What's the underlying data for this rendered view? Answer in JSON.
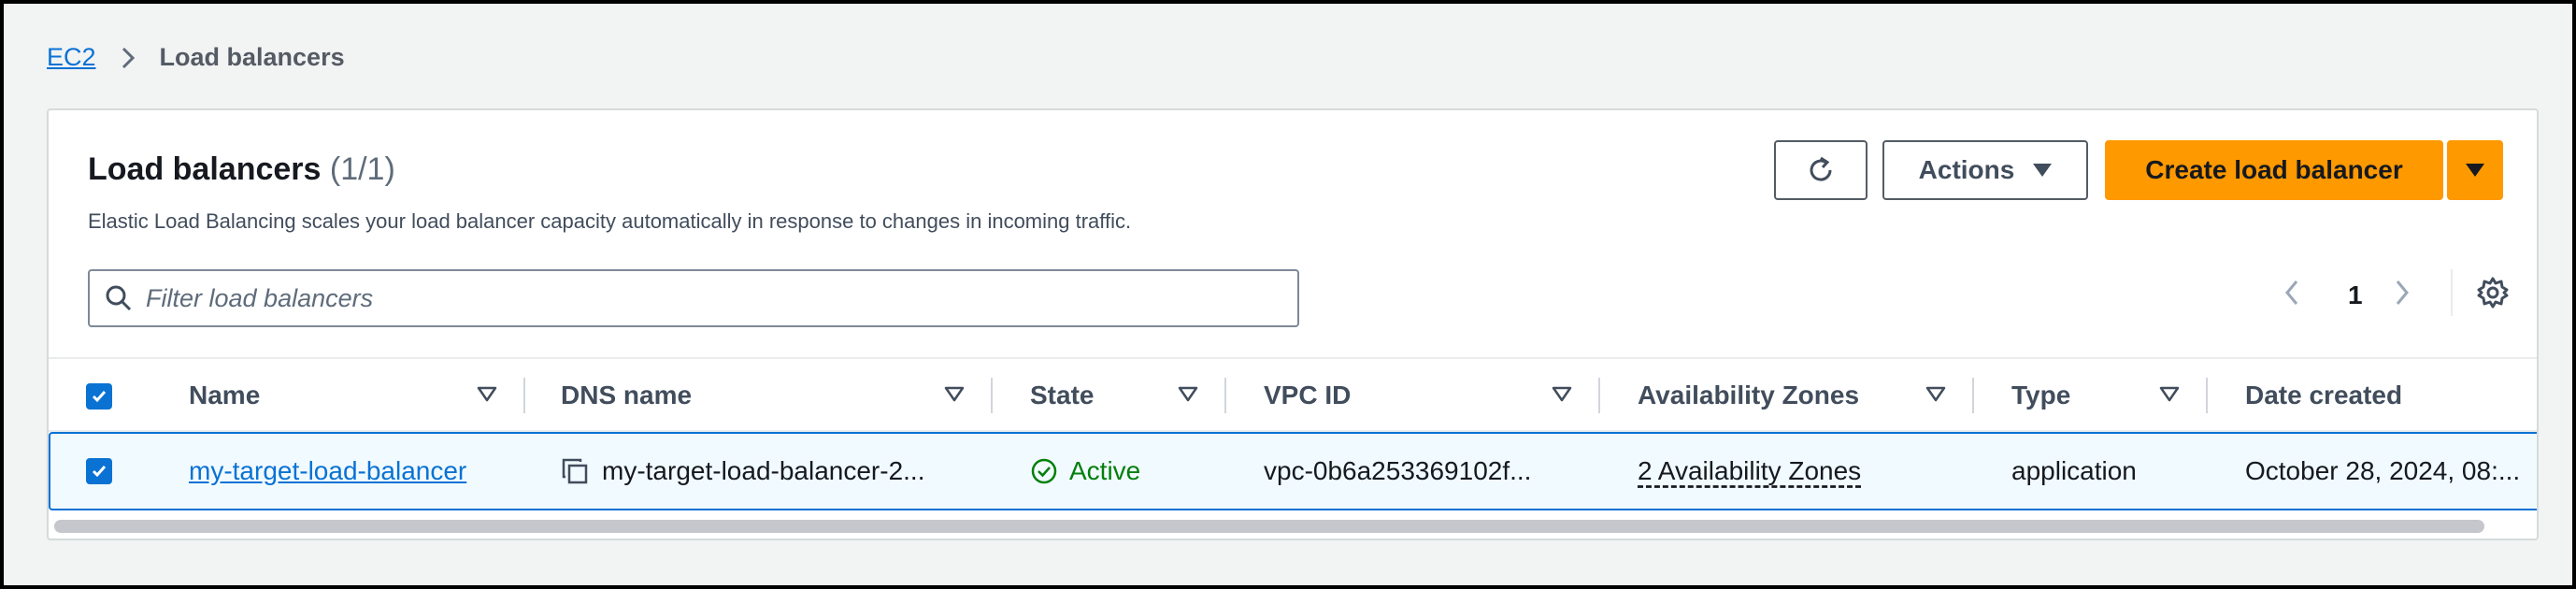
{
  "breadcrumb": {
    "root": "EC2",
    "current": "Load balancers"
  },
  "header": {
    "title": "Load balancers",
    "count": "(1/1)",
    "description": "Elastic Load Balancing scales your load balancer capacity automatically in response to changes in incoming traffic."
  },
  "toolbar": {
    "actions_label": "Actions",
    "create_label": "Create load balancer"
  },
  "filter": {
    "placeholder": "Filter load balancers"
  },
  "pagination": {
    "current_page": "1"
  },
  "table": {
    "columns": [
      "Name",
      "DNS name",
      "State",
      "VPC ID",
      "Availability Zones",
      "Type",
      "Date created"
    ],
    "rows": [
      {
        "name": "my-target-load-balancer",
        "dns_name": "my-target-load-balancer-2...",
        "state": "Active",
        "vpc_id": "vpc-0b6a253369102f...",
        "availability_zones": "2 Availability Zones",
        "type": "application",
        "date_created": "October 28, 2024, 08:..."
      }
    ]
  },
  "colors": {
    "accent": "#0972d3",
    "primary_button": "#ff9900",
    "status_active": "#037f0c"
  },
  "icons": [
    "chevron-right-icon",
    "refresh-icon",
    "caret-down-icon",
    "search-icon",
    "chevron-left-icon",
    "gear-icon",
    "sort-icon",
    "copy-icon",
    "check-circle-icon",
    "checkbox-checked-icon"
  ]
}
